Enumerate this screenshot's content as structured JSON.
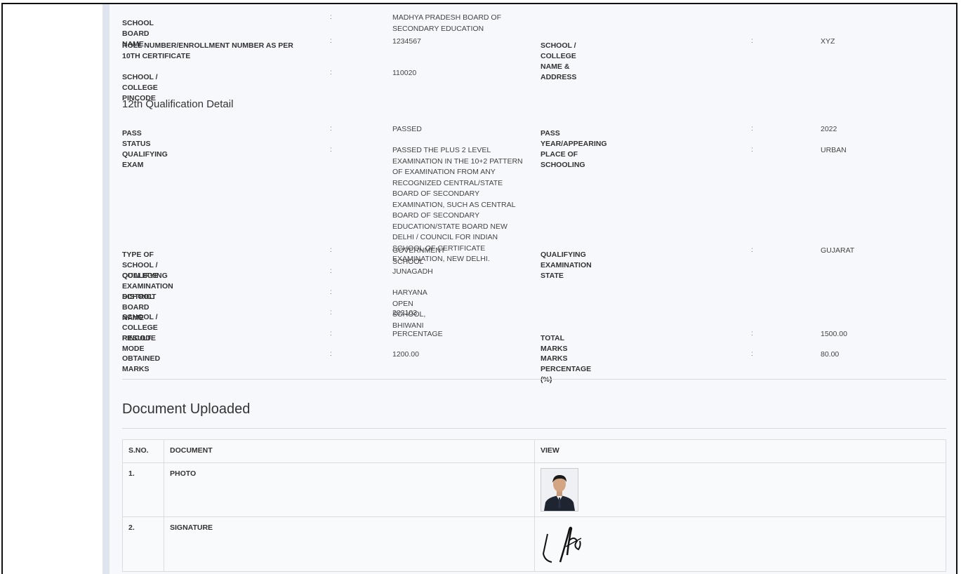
{
  "tenth": {
    "rows": [
      {
        "label": "SCHOOL BOARD NAME",
        "value": "MADHYA PRADESH BOARD OF SECONDARY EDUCATION"
      },
      {
        "label": "ROLL NUMBER/ENROLLMENT NUMBER AS PER 10TH CERTIFICATE",
        "value": "1234567",
        "label2": "SCHOOL / COLLEGE NAME & ADDRESS",
        "value2": "XYZ"
      },
      {
        "label": "SCHOOL / COLLEGE PINCODE",
        "value": "110020"
      }
    ]
  },
  "twelfth": {
    "heading": "12th Qualification Detail",
    "rows": [
      {
        "label": "PASS STATUS",
        "value": "PASSED",
        "label2": "PASS YEAR/APPEARING",
        "value2": "2022"
      },
      {
        "label": "QUALIFYING EXAM",
        "value": "PASSED THE PLUS 2 LEVEL EXAMINATION IN THE 10+2 PATTERN OF EXAMINATION FROM ANY RECOGNIZED CENTRAL/STATE BOARD OF SECONDARY EXAMINATION, SUCH AS CENTRAL BOARD OF SECONDARY EDUCATION/STATE BOARD NEW DELHI / COUNCIL FOR INDIAN SCHOOL OF CERTIFICATE EXAMINATION, NEW DELHI.",
        "label2": "PLACE OF SCHOOLING",
        "value2": "URBAN"
      },
      {
        "label": "TYPE OF SCHOOL / COLLEGE",
        "value": "GOVERNMENT SCHOOL",
        "label2": "QUALIFYING EXAMINATION STATE",
        "value2": "GUJARAT"
      },
      {
        "label": "QUALIFYING EXAMINATION DISTRICT",
        "value": "JUNAGADH"
      },
      {
        "label": "SCHOOL BOARD NAME",
        "value": "HARYANA OPEN SCHOOL, BHIWANI"
      },
      {
        "label": "SCHOOL / COLLEGE PINCODE",
        "value": "202103"
      },
      {
        "label": "RESULT MODE",
        "value": "PERCENTAGE",
        "label2": "TOTAL MARKS",
        "value2": "1500.00"
      },
      {
        "label": "OBTAINED MARKS",
        "value": "1200.00",
        "label2": "MARKS PERCENTAGE (%)",
        "value2": "80.00"
      }
    ]
  },
  "separator": ":",
  "documents": {
    "heading": "Document Uploaded",
    "columns": [
      "S.NO.",
      "DOCUMENT",
      "VIEW"
    ],
    "rows": [
      {
        "sno": "1.",
        "name": "PHOTO"
      },
      {
        "sno": "2.",
        "name": "SIGNATURE"
      }
    ]
  }
}
